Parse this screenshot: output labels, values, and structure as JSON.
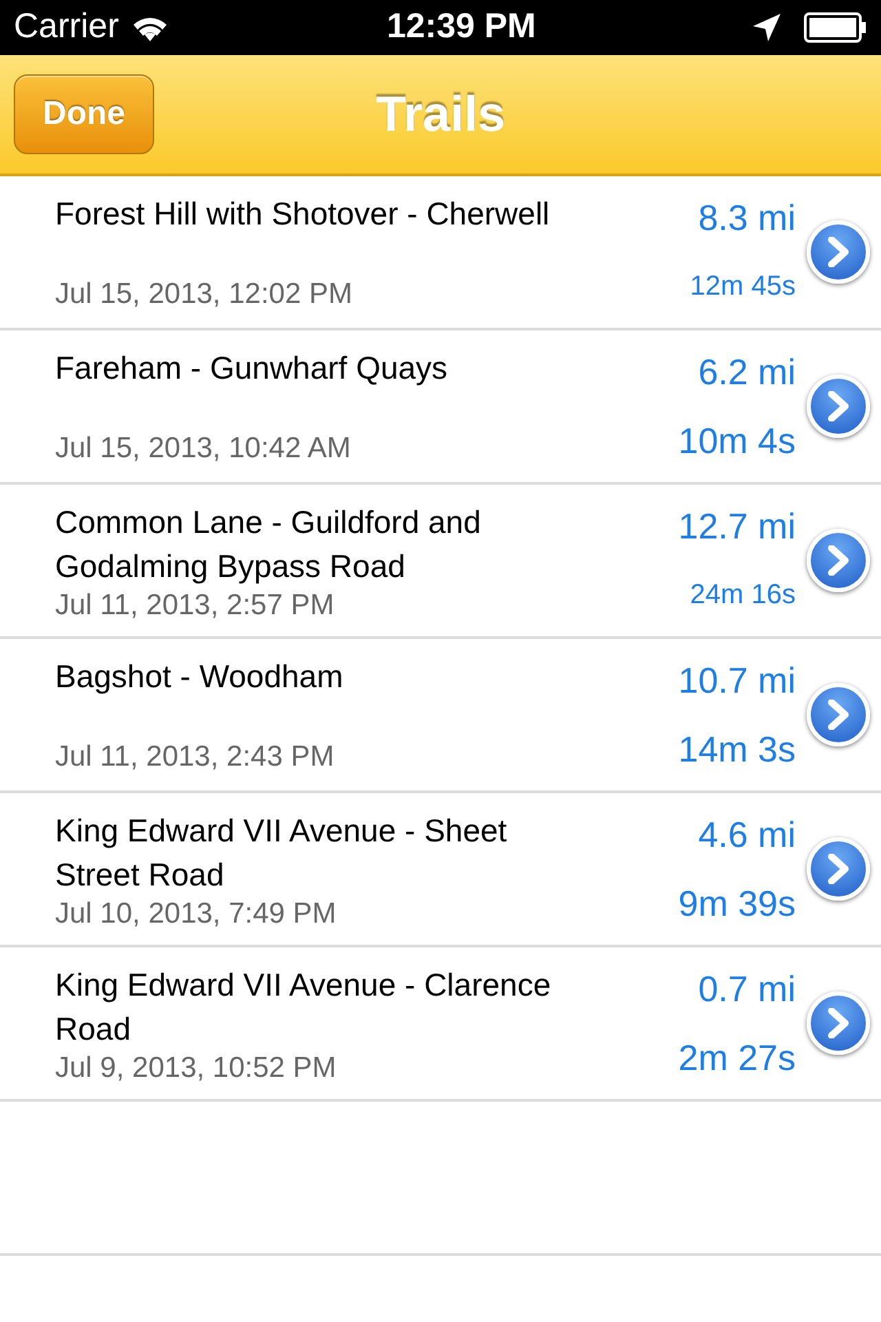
{
  "status_bar": {
    "carrier": "Carrier",
    "time": "12:39 PM"
  },
  "nav_bar": {
    "title": "Trails",
    "left_button": "Done"
  },
  "trails": [
    {
      "title": "Forest Hill with Shotover - Cherwell",
      "date": "Jul 15, 2013, 12:02 PM",
      "distance": "8.3 mi",
      "duration": "12m 45s",
      "duration_small": true
    },
    {
      "title": "Fareham - Gunwharf Quays",
      "date": "Jul 15, 2013, 10:42 AM",
      "distance": "6.2 mi",
      "duration": "10m 4s",
      "duration_small": false
    },
    {
      "title": "Common Lane - Guildford and Godalming Bypass Road",
      "date": "Jul 11, 2013, 2:57 PM",
      "distance": "12.7 mi",
      "duration": "24m 16s",
      "duration_small": true
    },
    {
      "title": "Bagshot - Woodham",
      "date": "Jul 11, 2013, 2:43 PM",
      "distance": "10.7 mi",
      "duration": "14m 3s",
      "duration_small": false
    },
    {
      "title": "King Edward VII Avenue - Sheet Street Road",
      "date": "Jul 10, 2013, 7:49 PM",
      "distance": "4.6 mi",
      "duration": "9m 39s",
      "duration_small": false
    },
    {
      "title": "King Edward VII Avenue - Clarence Road",
      "date": "Jul 9, 2013, 10:52 PM",
      "distance": "0.7 mi",
      "duration": "2m 27s",
      "duration_small": false
    }
  ]
}
